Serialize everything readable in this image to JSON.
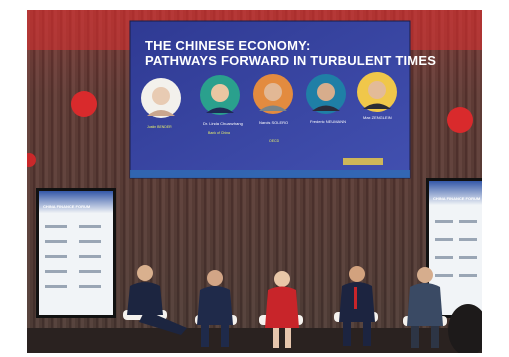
{
  "slide": {
    "title_line1": "THE CHINESE ECONOMY:",
    "title_line2": "PATHWAYS FORWARD IN TURBULENT TIMES",
    "speakers": [
      {
        "name": "Justin BENDER",
        "role": "",
        "org": ""
      },
      {
        "name": "Dr. Linda Chuanzhang",
        "role": "",
        "org": "Bank of China"
      },
      {
        "name": "Narcis SOLERO",
        "role": "",
        "org": "OECD"
      },
      {
        "name": "Frederic NEUMANN",
        "role": "",
        "org": ""
      },
      {
        "name": "Max ZENGLEIN",
        "role": "",
        "org": ""
      }
    ]
  },
  "side_screens": {
    "left_title": "CHINA FINANCE FORUM",
    "right_title": "CHINA FINANCE FORUM"
  },
  "colors": {
    "slide_bg": "#3b3f9c",
    "curtain": "#4a3b36",
    "stage_light": "#d9262a",
    "dress_red": "#c8252a"
  },
  "panel": {
    "count": 5
  }
}
